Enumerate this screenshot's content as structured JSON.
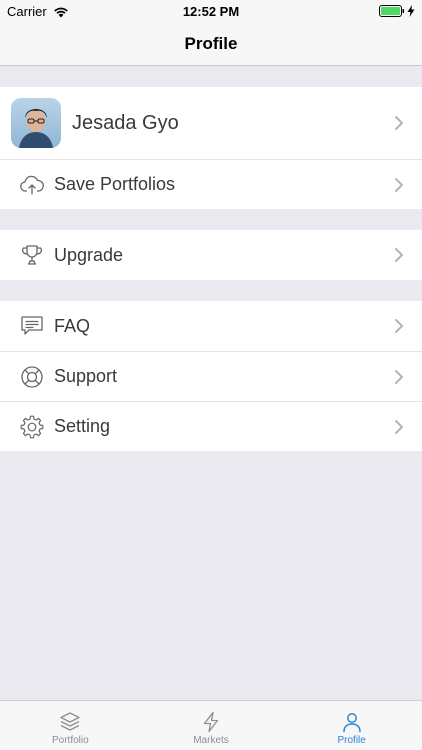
{
  "status_bar": {
    "carrier": "Carrier",
    "time": "12:52 PM"
  },
  "nav": {
    "title": "Profile"
  },
  "profile": {
    "name": "Jesada Gyo"
  },
  "groups": {
    "g1": [
      {
        "label": "Save Portfolios",
        "icon": "cloud-upload-icon"
      }
    ],
    "g2": [
      {
        "label": "Upgrade",
        "icon": "trophy-icon"
      }
    ],
    "g3": [
      {
        "label": "FAQ",
        "icon": "chat-icon"
      },
      {
        "label": "Support",
        "icon": "lifebuoy-icon"
      },
      {
        "label": "Setting",
        "icon": "gear-icon"
      }
    ]
  },
  "tabs": [
    {
      "label": "Portfolio",
      "icon": "layers-icon"
    },
    {
      "label": "Markets",
      "icon": "lightning-icon"
    },
    {
      "label": "Profile",
      "icon": "person-icon",
      "active": true
    }
  ],
  "colors": {
    "accent": "#2b86d8",
    "background": "#e9e9ef"
  }
}
